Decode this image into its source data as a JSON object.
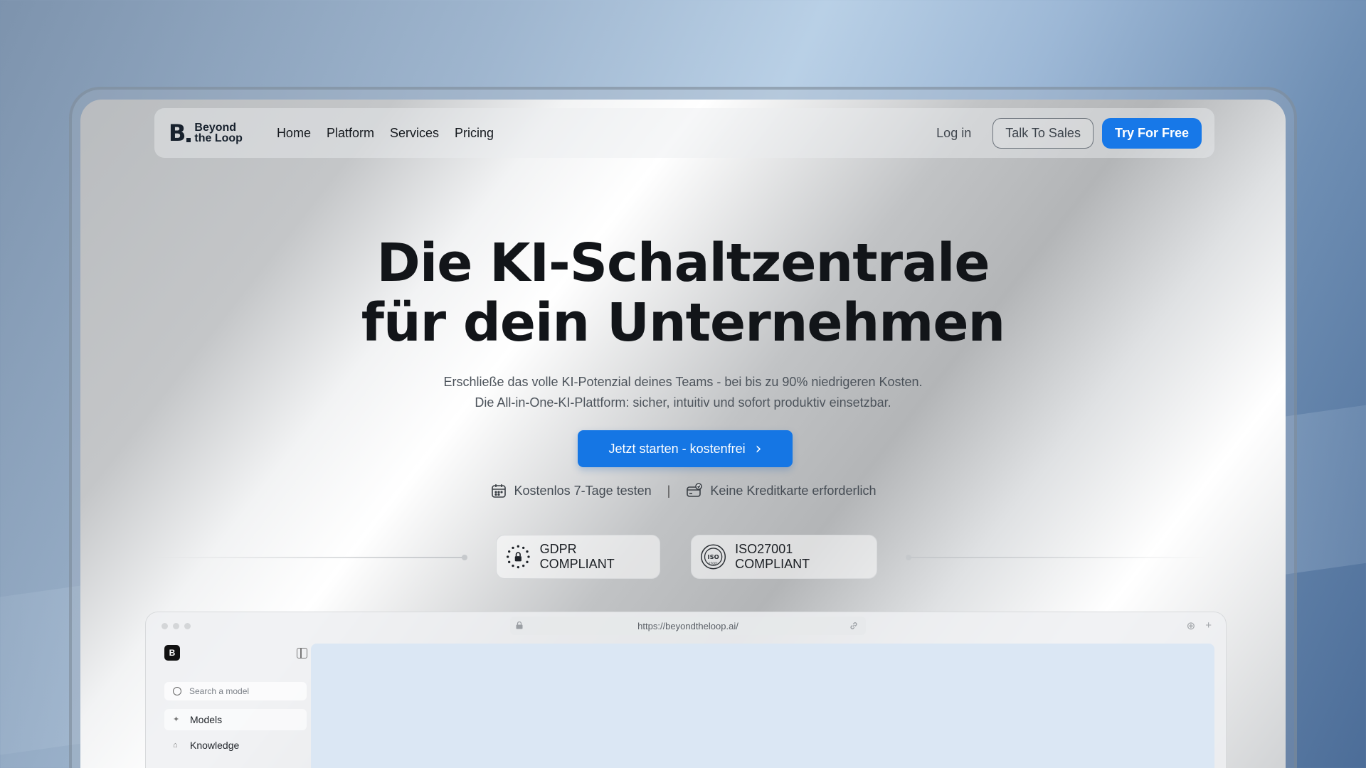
{
  "nav": {
    "logo_mark": "B",
    "logo_line1": "Beyond",
    "logo_line2": "the Loop",
    "links": [
      "Home",
      "Platform",
      "Services",
      "Pricing"
    ],
    "login": "Log in",
    "talk_to_sales": "Talk To Sales",
    "try_for_free": "Try For Free"
  },
  "hero": {
    "title_line1": "Die KI-Schaltzentrale",
    "title_line2": "für dein Unternehmen",
    "subtitle_line1": "Erschließe das volle KI-Potenzial deines Teams - bei bis zu 90% niedrigeren Kosten.",
    "subtitle_line2": "Die All-in-One-KI-Plattform: sicher, intuitiv und sofort produktiv einsetzbar.",
    "cta": "Jetzt starten - kostenfrei",
    "cta_icon": "chevron-right",
    "perk1": "Kostenlos 7-Tage testen",
    "perk1_icon": "calendar",
    "separator": "|",
    "perk2": "Keine Kreditkarte erforderlich",
    "perk2_icon": "credit-card"
  },
  "badges": {
    "gdpr": "GDPR COMPLIANT",
    "gdpr_icon": "eu-stars-lock",
    "iso": "ISO27001 COMPLIANT",
    "iso_icon": "iso-seal"
  },
  "preview": {
    "url": "https://beyondtheloop.ai/",
    "app_logo": "B",
    "search_placeholder": "Search a model",
    "sidebar_items": [
      "Models",
      "Knowledge"
    ]
  },
  "colors": {
    "primary": "#1778e8",
    "text_dark": "#121519",
    "text_muted": "#4c535b"
  }
}
